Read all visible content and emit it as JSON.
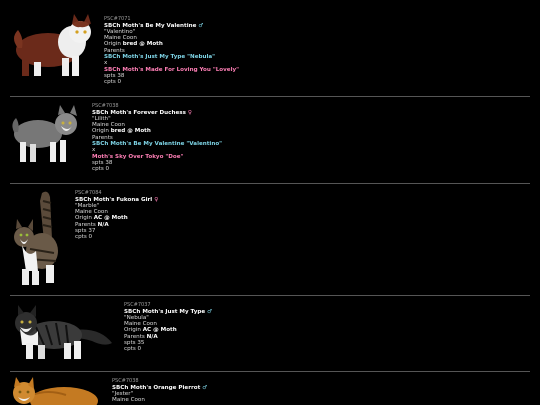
{
  "sex_symbols": {
    "male": "♂",
    "female": "♀"
  },
  "colors": {
    "male_link": "#7fd6e8",
    "female_link": "#ff7fb6",
    "background": "#000000"
  },
  "cats": [
    {
      "reg_id": "PSC#7071",
      "name": "SBCh Moth's Be My Valentine",
      "sex": "male",
      "nickname": "\"Valentino\"",
      "breed": "Maine Coon",
      "origin_label": "Origin",
      "origin_value": "bred @ Moth",
      "parents_label": "Parents",
      "parents_value": "",
      "sire": "SBCh Moth's Just My Type \"Nebula\"",
      "dam": "SBCh Moth's Made For Loving You \"Lovely\"",
      "cross": "x",
      "spts": "spts 38",
      "cpts": "cpts 0"
    },
    {
      "reg_id": "PSC#7038",
      "name": "SBCh Moth's Forever Duchess",
      "sex": "female",
      "nickname": "\"Lilith\"",
      "breed": "Maine Coon",
      "origin_label": "Origin",
      "origin_value": "bred @ Moth",
      "parents_label": "Parents",
      "parents_value": "",
      "sire": "SBCh Moth's Be My Valentine \"Valentino\"",
      "dam": "Moth's Sky Over Tokyo \"Doe\"",
      "cross": "x",
      "spts": "spts 38",
      "cpts": "cpts 0"
    },
    {
      "reg_id": "PSC#7084",
      "name": "SBCh Moth's Fukona Girl",
      "sex": "female",
      "nickname": "\"Marble\"",
      "breed": "Maine Coon",
      "origin_label": "Origin",
      "origin_value": "AC @ Moth",
      "parents_label": "Parents",
      "parents_value": "N/A",
      "sire": "",
      "dam": "",
      "cross": "",
      "spts": "spts 37",
      "cpts": "cpts 0"
    },
    {
      "reg_id": "PSC#7037",
      "name": "SBCh Moth's Just My Type",
      "sex": "male",
      "nickname": "\"Nebula\"",
      "breed": "Maine Coon",
      "origin_label": "Origin",
      "origin_value": "AC @ Moth",
      "parents_label": "Parents",
      "parents_value": "N/A",
      "sire": "",
      "dam": "",
      "cross": "",
      "spts": "spts 35",
      "cpts": "cpts 0"
    },
    {
      "reg_id": "PSC#7038",
      "name": "SBCh Moth's Orange Pierrot",
      "sex": "male",
      "nickname": "\"Jester\"",
      "breed": "Maine Coon",
      "origin_label": "",
      "origin_value": "",
      "parents_label": "",
      "parents_value": "",
      "sire": "",
      "dam": "",
      "cross": "",
      "spts": "",
      "cpts": ""
    }
  ]
}
